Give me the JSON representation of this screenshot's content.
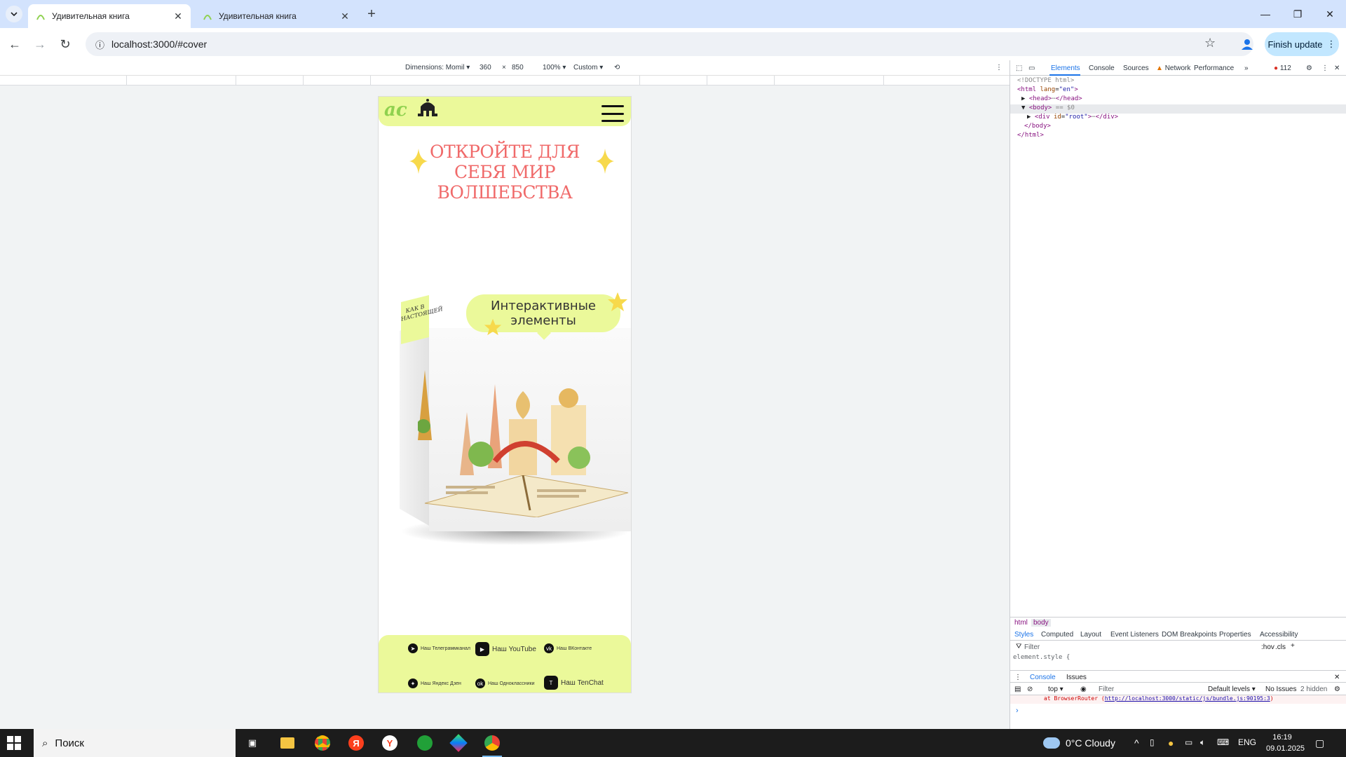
{
  "browser": {
    "tabs": [
      {
        "title": "Удивительная книга",
        "active": true
      },
      {
        "title": "Удивительная книга",
        "active": false
      }
    ],
    "url": "localhost:3000/#cover",
    "finish_update": "Finish update"
  },
  "device_toolbar": {
    "dimensions_label": "Dimensions: Momil",
    "width": "360",
    "times": "×",
    "height": "850",
    "zoom": "100%",
    "throttle": "Custom"
  },
  "site": {
    "logo_text": "ас",
    "hero_title": "ОТКРОЙТЕ ДЛЯ СЕБЯ МИР ВОЛШЕБСТВА",
    "bubble_text": "Интерактивные элементы",
    "ribbon_text": "КАК В НАСТОЯЩЕЙ",
    "socials": [
      {
        "label": "Наш Телеграммканал",
        "icon": "telegram-icon"
      },
      {
        "label": "Наш YouTube",
        "icon": "youtube-icon"
      },
      {
        "label": "Наш ВКонтакте",
        "icon": "vk-icon"
      },
      {
        "label": "Наш Яндекс Дзен",
        "icon": "dzen-icon"
      },
      {
        "label": "Наш Одноклассники",
        "icon": "ok-icon"
      },
      {
        "label": "Наш TenChat",
        "icon": "tenchat-icon"
      }
    ]
  },
  "devtools": {
    "tabs": [
      "Elements",
      "Console",
      "Sources",
      "Network",
      "Performance"
    ],
    "error_count": "112",
    "dom": {
      "doctype": "<!DOCTYPE html>",
      "html_open_tag": "<html",
      "html_lang_attr": "lang",
      "html_lang_val": "\"en\"",
      "head": "<head>",
      "head_close": "</head>",
      "body": "<body>",
      "body_marker": "== $0",
      "root_div": "<div",
      "root_attr": "id",
      "root_val": "\"root\"",
      "root_close": "</div>",
      "body_close": "</body>",
      "html_close": "</html>"
    },
    "breadcrumbs": [
      "html",
      "body"
    ],
    "styles_tabs": [
      "Styles",
      "Computed",
      "Layout",
      "Event Listeners",
      "DOM Breakpoints",
      "Properties",
      "Accessibility"
    ],
    "filter_placeholder": "Filter",
    "hov": ":hov",
    "cls": ".cls",
    "element_style": "element.style {",
    "console_tabs": [
      "Console",
      "Issues"
    ],
    "console_context": "top",
    "console_filter": "Filter",
    "default_levels": "Default levels",
    "no_issues": "No Issues",
    "hidden": "2 hidden",
    "error_prefix": "at BrowserRouter (",
    "error_link": "http://localhost:3000/static/js/bundle.js:90195:3",
    "error_suffix": ")"
  },
  "taskbar": {
    "search_placeholder": "Поиск",
    "weather": "0°C  Cloudy",
    "lang": "ENG",
    "time": "16:19",
    "date": "09.01.2025"
  },
  "colors": {
    "lime": "#ebf99a",
    "title_red": "#f06a6a",
    "star_yellow": "#f7d94c",
    "chrome_frame": "#d3e3fd"
  }
}
